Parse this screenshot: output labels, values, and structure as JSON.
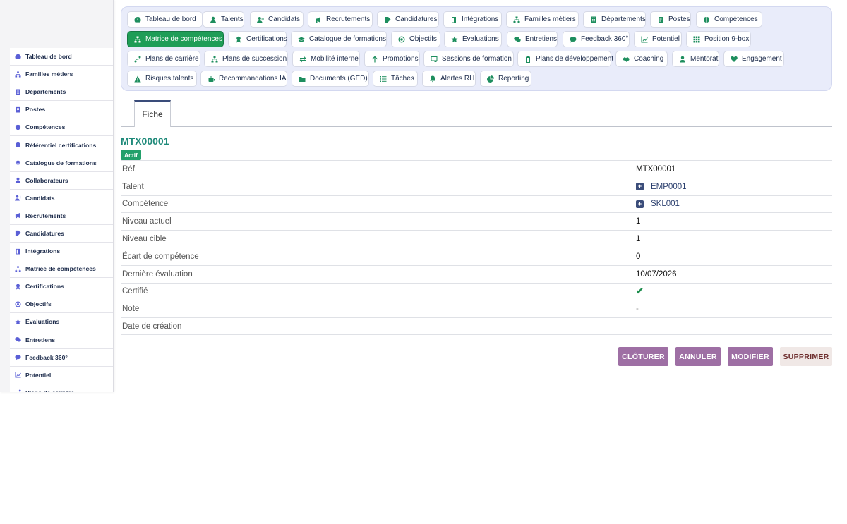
{
  "nav_chips": [
    {
      "label": "Tableau de bord",
      "icon": "dashboard-icon"
    },
    {
      "label": "Talents",
      "icon": "user-icon"
    },
    {
      "label": "Candidats",
      "icon": "user-plus-icon"
    },
    {
      "label": "Recrutements",
      "icon": "megaphone-icon"
    },
    {
      "label": "Candidatures",
      "icon": "file-edit-icon"
    },
    {
      "label": "Intégrations",
      "icon": "door-icon"
    },
    {
      "label": "Familles métiers",
      "icon": "sitemap-icon"
    },
    {
      "label": "Départements",
      "icon": "building-icon"
    },
    {
      "label": "Postes",
      "icon": "badge-icon"
    },
    {
      "label": "Compétences",
      "icon": "brain-icon"
    },
    {
      "label": "Matrice de compétences",
      "icon": "sitemap-icon",
      "active": true
    },
    {
      "label": "Certifications",
      "icon": "award-icon"
    },
    {
      "label": "Catalogue de formations",
      "icon": "graduation-cap-icon"
    },
    {
      "label": "Objectifs",
      "icon": "target-icon"
    },
    {
      "label": "Évaluations",
      "icon": "star-icon"
    },
    {
      "label": "Entretiens",
      "icon": "comments-icon"
    },
    {
      "label": "Feedback 360°",
      "icon": "comment-icon"
    },
    {
      "label": "Potentiel",
      "icon": "chart-line-icon"
    },
    {
      "label": "Position 9-box",
      "icon": "grid-icon"
    },
    {
      "label": "Plans de carrière",
      "icon": "route-icon"
    },
    {
      "label": "Plans de succession",
      "icon": "sitemap-icon"
    },
    {
      "label": "Mobilité interne",
      "icon": "exchange-icon"
    },
    {
      "label": "Promotions",
      "icon": "arrow-up-icon"
    },
    {
      "label": "Sessions de formation",
      "icon": "chalkboard-icon"
    },
    {
      "label": "Plans de développement",
      "icon": "clipboard-icon"
    },
    {
      "label": "Coaching",
      "icon": "handshake-icon"
    },
    {
      "label": "Mentorat",
      "icon": "user-tie-icon"
    },
    {
      "label": "Engagement",
      "icon": "heart-icon"
    },
    {
      "label": "Risques talents",
      "icon": "warning-icon"
    },
    {
      "label": "Recommandations IA",
      "icon": "robot-icon"
    },
    {
      "label": "Documents (GED)",
      "icon": "folder-icon"
    },
    {
      "label": "Tâches",
      "icon": "list-icon"
    },
    {
      "label": "Alertes RH",
      "icon": "bell-icon"
    },
    {
      "label": "Reporting",
      "icon": "pie-chart-icon"
    }
  ],
  "sidebar": {
    "items": [
      {
        "label": "Tableau de bord",
        "icon": "dashboard-icon"
      },
      {
        "label": "Familles métiers",
        "icon": "sitemap-icon"
      },
      {
        "label": "Départements",
        "icon": "building-icon"
      },
      {
        "label": "Postes",
        "icon": "badge-icon"
      },
      {
        "label": "Compétences",
        "icon": "brain-icon"
      },
      {
        "label": "Référentiel certifications",
        "icon": "certificate-icon"
      },
      {
        "label": "Catalogue de formations",
        "icon": "graduation-cap-icon"
      },
      {
        "label": "Collaborateurs",
        "icon": "user-icon"
      },
      {
        "label": "Candidats",
        "icon": "user-plus-icon"
      },
      {
        "label": "Recrutements",
        "icon": "megaphone-icon"
      },
      {
        "label": "Candidatures",
        "icon": "file-edit-icon"
      },
      {
        "label": "Intégrations",
        "icon": "door-icon"
      },
      {
        "label": "Matrice de compétences",
        "icon": "sitemap-icon"
      },
      {
        "label": "Certifications",
        "icon": "award-icon"
      },
      {
        "label": "Objectifs",
        "icon": "target-icon"
      },
      {
        "label": "Évaluations",
        "icon": "star-icon"
      },
      {
        "label": "Entretiens",
        "icon": "comments-icon"
      },
      {
        "label": "Feedback 360°",
        "icon": "comment-icon"
      },
      {
        "label": "Potentiel",
        "icon": "chart-line-icon"
      },
      {
        "label": "Plans de carrière",
        "icon": "route-icon"
      }
    ]
  },
  "tabs": {
    "fiche": "Fiche"
  },
  "record": {
    "title": "MTX00001",
    "status": "Actif",
    "fields": [
      {
        "label": "Réf.",
        "value": "MTX00001"
      },
      {
        "label": "Talent",
        "value": "EMP0001",
        "link": true
      },
      {
        "label": "Compétence",
        "value": "SKL001",
        "link": true
      },
      {
        "label": "Niveau actuel",
        "value": "1"
      },
      {
        "label": "Niveau cible",
        "value": "1"
      },
      {
        "label": "Écart de compétence",
        "value": "0"
      },
      {
        "label": "Dernière évaluation",
        "value": "10/07/2026"
      },
      {
        "label": "Certifié",
        "value": "✔",
        "check": true
      },
      {
        "label": "Note",
        "value": "-",
        "muted": true
      },
      {
        "label": "Date de création",
        "value": ""
      }
    ]
  },
  "actions": {
    "close": "CLÔTURER",
    "cancel": "ANNULER",
    "edit": "MODIFIER",
    "delete": "SUPPRIMER"
  },
  "colors": {
    "accent": "#1f9d57",
    "title": "#1f8a7a",
    "button": "#9e6fa4"
  }
}
